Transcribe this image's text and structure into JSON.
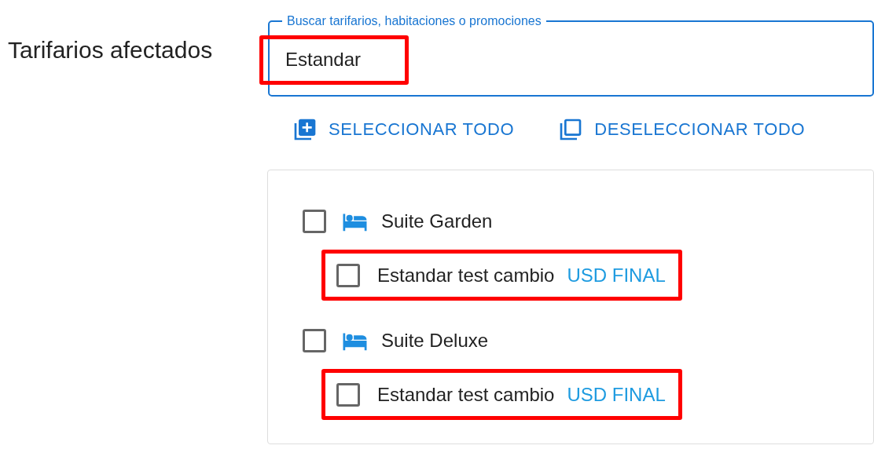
{
  "section_label": "Tarifarios afectados",
  "search": {
    "label": "Buscar tarifarios, habitaciones o promociones",
    "value": "Estandar",
    "highlighted": true
  },
  "actions": [
    {
      "kind": "select_all",
      "label": "SELECCIONAR TODO"
    },
    {
      "kind": "deselect_all",
      "label": "DESELECCIONAR TODO"
    }
  ],
  "rooms": [
    {
      "name": "Suite Garden",
      "checked": false,
      "rates": [
        {
          "name": "Estandar test cambio",
          "tag": "USD FINAL",
          "checked": false,
          "highlighted": true
        }
      ]
    },
    {
      "name": "Suite Deluxe",
      "checked": false,
      "rates": [
        {
          "name": "Estandar test cambio",
          "tag": "USD FINAL",
          "checked": false,
          "highlighted": true
        }
      ]
    }
  ]
}
